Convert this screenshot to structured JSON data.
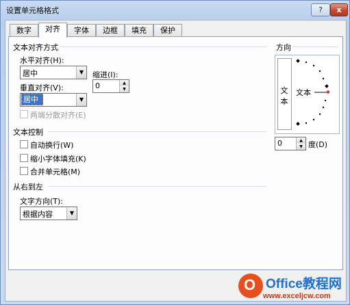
{
  "window": {
    "title": "设置单元格格式",
    "help_label": "?",
    "close_label": "x"
  },
  "tabs": [
    {
      "label": "数字",
      "active": false
    },
    {
      "label": "对齐",
      "active": true
    },
    {
      "label": "字体",
      "active": false
    },
    {
      "label": "边框",
      "active": false
    },
    {
      "label": "填充",
      "active": false
    },
    {
      "label": "保护",
      "active": false
    }
  ],
  "text_alignment": {
    "title": "文本对齐方式",
    "horizontal_label": "水平对齐(H):",
    "horizontal_value": "居中",
    "indent_label": "缩进(I):",
    "indent_value": "0",
    "vertical_label": "垂直对齐(V):",
    "vertical_value": "居中",
    "distributed_label": "两端分散对齐(E)",
    "distributed_checked": false,
    "distributed_enabled": false
  },
  "text_control": {
    "title": "文本控制",
    "wrap_label": "自动换行(W)",
    "wrap_checked": false,
    "shrink_label": "缩小字体填充(K)",
    "shrink_checked": false,
    "merge_label": "合并单元格(M)",
    "merge_checked": false
  },
  "rtl": {
    "title": "从右到左",
    "direction_label": "文字方向(T):",
    "direction_value": "根据内容"
  },
  "orientation": {
    "title": "方向",
    "vertical_text": [
      "文",
      "本"
    ],
    "dial_text": "文本",
    "degree_value": "0",
    "degree_label": "度(D)"
  },
  "watermark": {
    "brand": "Office教程网",
    "url": "www.exceljcw.com"
  },
  "colors": {
    "accent": "#3a74d0",
    "close": "#c24a32",
    "dial_marker": "#c0392b"
  }
}
